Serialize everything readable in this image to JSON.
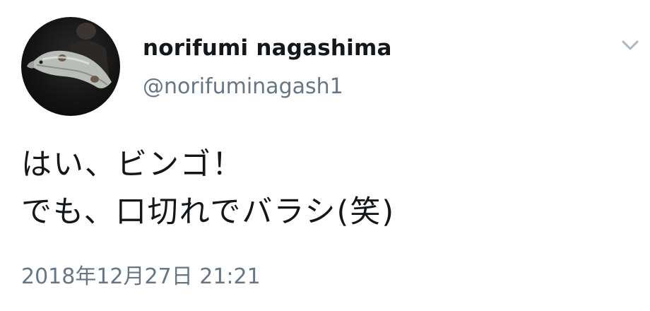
{
  "tweet": {
    "display_name": "norifumi nagashima",
    "handle": "@norifuminagash1",
    "text_lines": [
      "はい、ビンゴ！",
      "でも、口切れでバラシ(笑)"
    ],
    "timestamp": "2018年12月27日 21:21"
  },
  "icons": {
    "menu": "chevron-down-icon",
    "avatar": "profile-photo"
  },
  "colors": {
    "text": "#14171a",
    "secondary": "#657786",
    "chevron": "#aab8c2",
    "background": "#ffffff"
  }
}
